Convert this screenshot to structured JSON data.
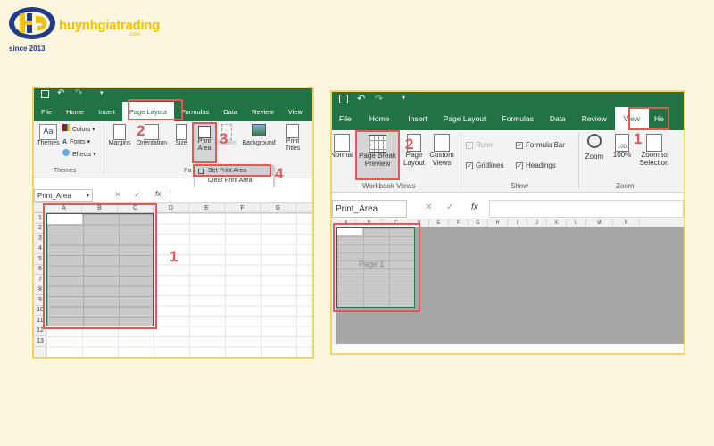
{
  "brand": {
    "name": "huynhgiatrading",
    "domain_suffix": ".com",
    "since": "since 2013"
  },
  "left": {
    "tabs": [
      "File",
      "Home",
      "Insert",
      "Page Layout",
      "Formulas",
      "Data",
      "Review",
      "View"
    ],
    "ribbon": {
      "themes": "Themes",
      "colors": "Colors",
      "fonts": "Fonts",
      "effects": "Effects",
      "themes_group": "Themes",
      "margins": "Margins",
      "orientation": "Orientation",
      "size": "Size",
      "print_area": "Print Area",
      "breaks": "Breaks",
      "background": "Background",
      "print_titles": "Print Titles",
      "page_group": "Pa"
    },
    "dropdown": {
      "set": "Set Print Area",
      "clear": "Clear Print Area"
    },
    "name_box": "Print_Area",
    "fx": "fx",
    "columns": [
      "A",
      "B",
      "C",
      "D",
      "E",
      "F",
      "G"
    ],
    "rows": [
      "1",
      "2",
      "3",
      "4",
      "5",
      "6",
      "7",
      "8",
      "9",
      "10",
      "11",
      "12",
      "13"
    ],
    "steps": {
      "s1": "1",
      "s2": "2",
      "s3": "3",
      "s4": "4"
    }
  },
  "right": {
    "tabs": [
      "File",
      "Home",
      "Insert",
      "Page Layout",
      "Formulas",
      "Data",
      "Review",
      "View",
      "He"
    ],
    "ribbon": {
      "normal": "Normal",
      "page_break": "Page Break Preview",
      "page_layout": "Page Layout",
      "custom_views": "Custom Views",
      "ruler": "Ruler",
      "formula_bar": "Formula Bar",
      "gridlines": "Gridlines",
      "headings": "Headings",
      "zoom": "Zoom",
      "zoom100": "100%",
      "zoom_sel": "Zoom to Selection",
      "group_wbviews": "Workbook Views",
      "group_show": "Show",
      "group_zoom": "Zoom"
    },
    "name_box": "Print_Area",
    "fx": "fx",
    "columns": [
      "A",
      "B",
      "C",
      "D",
      "E",
      "F",
      "G",
      "H",
      "I",
      "J",
      "K",
      "L",
      "M",
      "N"
    ],
    "page_label": "Page 1",
    "steps": {
      "s1": "1",
      "s2": "2"
    }
  }
}
